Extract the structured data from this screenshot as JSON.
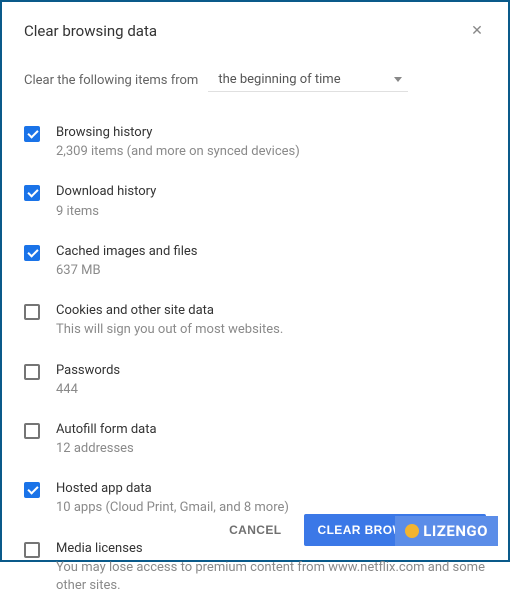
{
  "title": "Clear browsing data",
  "close": "✕",
  "time_label": "Clear the following items from",
  "time_value": "the beginning of time",
  "items": [
    {
      "label": "Browsing history",
      "sub": "2,309 items (and more on synced devices)",
      "checked": true
    },
    {
      "label": "Download history",
      "sub": "9 items",
      "checked": true
    },
    {
      "label": "Cached images and files",
      "sub": "637 MB",
      "checked": true
    },
    {
      "label": "Cookies and other site data",
      "sub": "This will sign you out of most websites.",
      "checked": false
    },
    {
      "label": "Passwords",
      "sub": "444",
      "checked": false
    },
    {
      "label": "Autofill form data",
      "sub": "12 addresses",
      "checked": false
    },
    {
      "label": "Hosted app data",
      "sub": "10 apps (Cloud Print, Gmail, and 8 more)",
      "checked": true
    },
    {
      "label": "Media licenses",
      "sub": "You may lose access to premium content from www.netflix.com and some other sites.",
      "checked": false
    }
  ],
  "cancel": "CANCEL",
  "clear": "CLEAR BROWSING DATA",
  "watermark": "LIZENGO"
}
